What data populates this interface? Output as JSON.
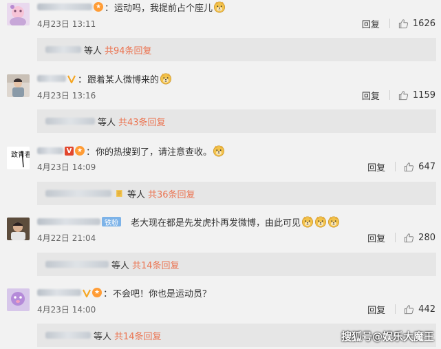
{
  "comments": [
    {
      "text": "运动吗，我提前占个座儿",
      "date": "4月23日 13:11",
      "reply_label": "回复",
      "likes": "1626",
      "replies_prefix": "等人",
      "replies_count": "共94条回复"
    },
    {
      "text": "跟着某人微博来的",
      "date": "4月23日 13:16",
      "reply_label": "回复",
      "likes": "1159",
      "replies_prefix": "等人",
      "replies_count": "共43条回复"
    },
    {
      "text": "你的热搜到了，请注意查收。",
      "date": "4月23日 14:09",
      "reply_label": "回复",
      "likes": "647",
      "replies_prefix": "等人",
      "replies_count": "共36条回复"
    },
    {
      "fan_badge": "铁粉",
      "text": "老大现在都是先发虎扑再发微博，由此可见",
      "date": "4月22日 21:04",
      "reply_label": "回复",
      "likes": "280",
      "replies_prefix": "等人",
      "replies_count": "共14条回复"
    },
    {
      "text": "不会吧！你也是运动员？",
      "date": "4月23日 14:00",
      "reply_label": "回复",
      "likes": "442",
      "replies_prefix": "等人",
      "replies_count": "共14条回复"
    }
  ],
  "colon": "：",
  "watermark": "搜狐号@娱乐大魔王",
  "avatar_3_text": "致青春",
  "colors": {
    "background": "#f2f2f2",
    "reply_box": "#e6e6e6",
    "reply_count": "#eb7350",
    "fan_badge": "#7db3e8",
    "verified_badge": "#e2472e"
  },
  "icons": [
    "thumbs-up-icon",
    "doge-emoji",
    "verified-v-icon",
    "medal-icon"
  ]
}
